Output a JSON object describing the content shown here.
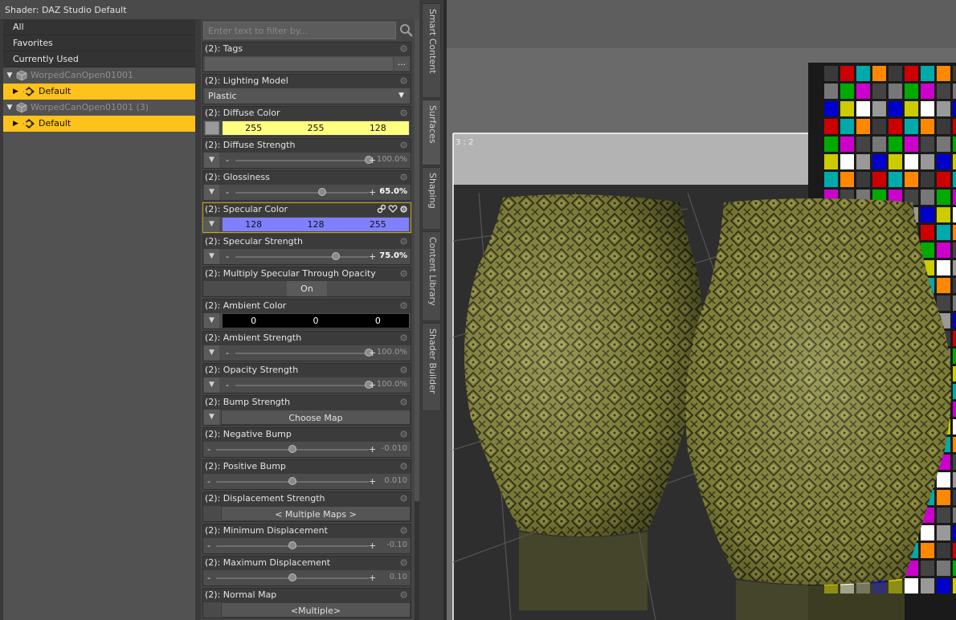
{
  "title": "Shader: DAZ Studio Default",
  "search_placeholder": "Enter text to filter by...",
  "tree": {
    "filters": [
      "All",
      "Favorites",
      "Currently Used"
    ],
    "nodes": [
      {
        "name": "WorpedCanOpen01001",
        "child": "Default"
      },
      {
        "name": "WorpedCanOpen01001 (3)",
        "child": "Default"
      }
    ]
  },
  "props": [
    {
      "label": "(2): Tags",
      "kind": "tags",
      "button": "..."
    },
    {
      "label": "(2): Lighting Model",
      "kind": "combo",
      "value": "Plastic"
    },
    {
      "label": "(2): Diffuse Color",
      "kind": "color",
      "r": "255",
      "g": "255",
      "b": "128",
      "color": "#ffff80"
    },
    {
      "label": "(2): Diffuse Strength",
      "kind": "slider",
      "value": "100.0%",
      "fraction": 1.0,
      "bold": false
    },
    {
      "label": "(2): Glossiness",
      "kind": "slider",
      "value": "65.0%",
      "fraction": 0.65,
      "bold": true
    },
    {
      "label": "(2): Specular Color",
      "kind": "color",
      "r": "128",
      "g": "128",
      "b": "255",
      "color": "#8080ff"
    },
    {
      "label": "(2): Specular Strength",
      "kind": "slider",
      "value": "75.0%",
      "fraction": 0.75,
      "bold": true
    },
    {
      "label": "(2): Multiply Specular Through Opacity",
      "kind": "toggle",
      "value": "On"
    },
    {
      "label": "(2): Ambient Color",
      "kind": "color",
      "r": "0",
      "g": "0",
      "b": "0",
      "color": "#000000"
    },
    {
      "label": "(2): Ambient Strength",
      "kind": "slider",
      "value": "100.0%",
      "fraction": 1.0,
      "bold": false
    },
    {
      "label": "(2): Opacity Strength",
      "kind": "slider",
      "value": "100.0%",
      "fraction": 1.0,
      "bold": false
    },
    {
      "label": "(2): Bump Strength",
      "kind": "map",
      "value": "Choose Map"
    },
    {
      "label": "(2): Negative Bump",
      "kind": "slider2",
      "value": "-0.010",
      "fraction": 0.5
    },
    {
      "label": "(2): Positive Bump",
      "kind": "slider2",
      "value": "0.010",
      "fraction": 0.5
    },
    {
      "label": "(2): Displacement Strength",
      "kind": "map",
      "value": "< Multiple Maps >"
    },
    {
      "label": "(2): Minimum Displacement",
      "kind": "slider2",
      "value": "-0.10",
      "fraction": 0.5
    },
    {
      "label": "(2): Maximum Displacement",
      "kind": "slider2",
      "value": "0.10",
      "fraction": 0.5
    },
    {
      "label": "(2): Normal Map",
      "kind": "map",
      "value": "<Multiple>"
    }
  ],
  "vtabs": [
    "Smart Content",
    "Surfaces",
    "Shaping",
    "Content Library",
    "Shader Builder"
  ],
  "viewport": {
    "aspect_label": "3 : 2"
  },
  "colors": {
    "selection": "#ffc21a",
    "highlight_border": "#c8a41c",
    "diffuse": "#ffff80",
    "specular": "#8080ff",
    "ambient": "#000000"
  }
}
